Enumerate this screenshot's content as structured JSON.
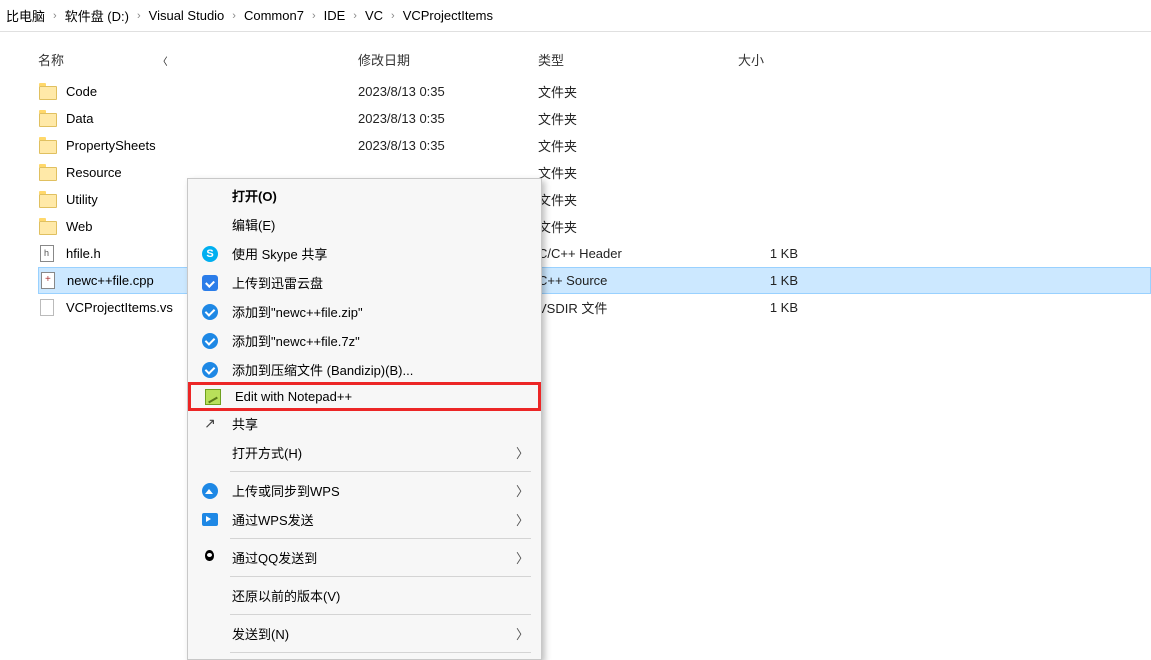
{
  "breadcrumb": [
    "比电脑",
    "软件盘 (D:)",
    "Visual Studio",
    "Common7",
    "IDE",
    "VC",
    "VCProjectItems"
  ],
  "columns": {
    "name": "名称",
    "date": "修改日期",
    "type": "类型",
    "size": "大小"
  },
  "files": [
    {
      "icon": "folder",
      "name": "Code",
      "date": "2023/8/13 0:35",
      "type": "文件夹",
      "size": ""
    },
    {
      "icon": "folder",
      "name": "Data",
      "date": "2023/8/13 0:35",
      "type": "文件夹",
      "size": ""
    },
    {
      "icon": "folder",
      "name": "PropertySheets",
      "date": "2023/8/13 0:35",
      "type": "文件夹",
      "size": ""
    },
    {
      "icon": "folder",
      "name": "Resource",
      "date": "",
      "type": "文件夹",
      "size": ""
    },
    {
      "icon": "folder",
      "name": "Utility",
      "date": "",
      "type": "文件夹",
      "size": ""
    },
    {
      "icon": "folder",
      "name": "Web",
      "date": "",
      "type": "文件夹",
      "size": ""
    },
    {
      "icon": "h",
      "name": "hfile.h",
      "date": "",
      "type": "C/C++ Header",
      "size": "1 KB"
    },
    {
      "icon": "cpp",
      "name": "newc++file.cpp",
      "date": "",
      "type": "C++ Source",
      "size": "1 KB",
      "selected": true
    },
    {
      "icon": "vs",
      "name": "VCProjectItems.vs",
      "date": "",
      "type": "VSDIR 文件",
      "size": "1 KB"
    }
  ],
  "context_menu": [
    {
      "kind": "item",
      "icon": "",
      "label": "打开(O)",
      "bold": true
    },
    {
      "kind": "item",
      "icon": "",
      "label": "编辑(E)"
    },
    {
      "kind": "item",
      "icon": "skype",
      "label": "使用 Skype 共享"
    },
    {
      "kind": "item",
      "icon": "xunlei",
      "label": "上传到迅雷云盘"
    },
    {
      "kind": "item",
      "icon": "bandizip",
      "label": "添加到\"newc++file.zip\""
    },
    {
      "kind": "item",
      "icon": "bandizip",
      "label": "添加到\"newc++file.7z\""
    },
    {
      "kind": "item",
      "icon": "bandizip",
      "label": "添加到压缩文件 (Bandizip)(B)..."
    },
    {
      "kind": "item",
      "icon": "npp",
      "label": "Edit with Notepad++",
      "highlight": true
    },
    {
      "kind": "item",
      "icon": "share",
      "label": "共享"
    },
    {
      "kind": "item",
      "icon": "",
      "label": "打开方式(H)",
      "submenu": true
    },
    {
      "kind": "sep"
    },
    {
      "kind": "item",
      "icon": "wpsup",
      "label": "上传或同步到WPS",
      "submenu": true
    },
    {
      "kind": "item",
      "icon": "wpssend",
      "label": "通过WPS发送",
      "submenu": true
    },
    {
      "kind": "sep"
    },
    {
      "kind": "item",
      "icon": "qq",
      "label": "通过QQ发送到",
      "submenu": true
    },
    {
      "kind": "sep"
    },
    {
      "kind": "item",
      "icon": "",
      "label": "还原以前的版本(V)"
    },
    {
      "kind": "sep"
    },
    {
      "kind": "item",
      "icon": "",
      "label": "发送到(N)",
      "submenu": true
    },
    {
      "kind": "sep"
    }
  ]
}
